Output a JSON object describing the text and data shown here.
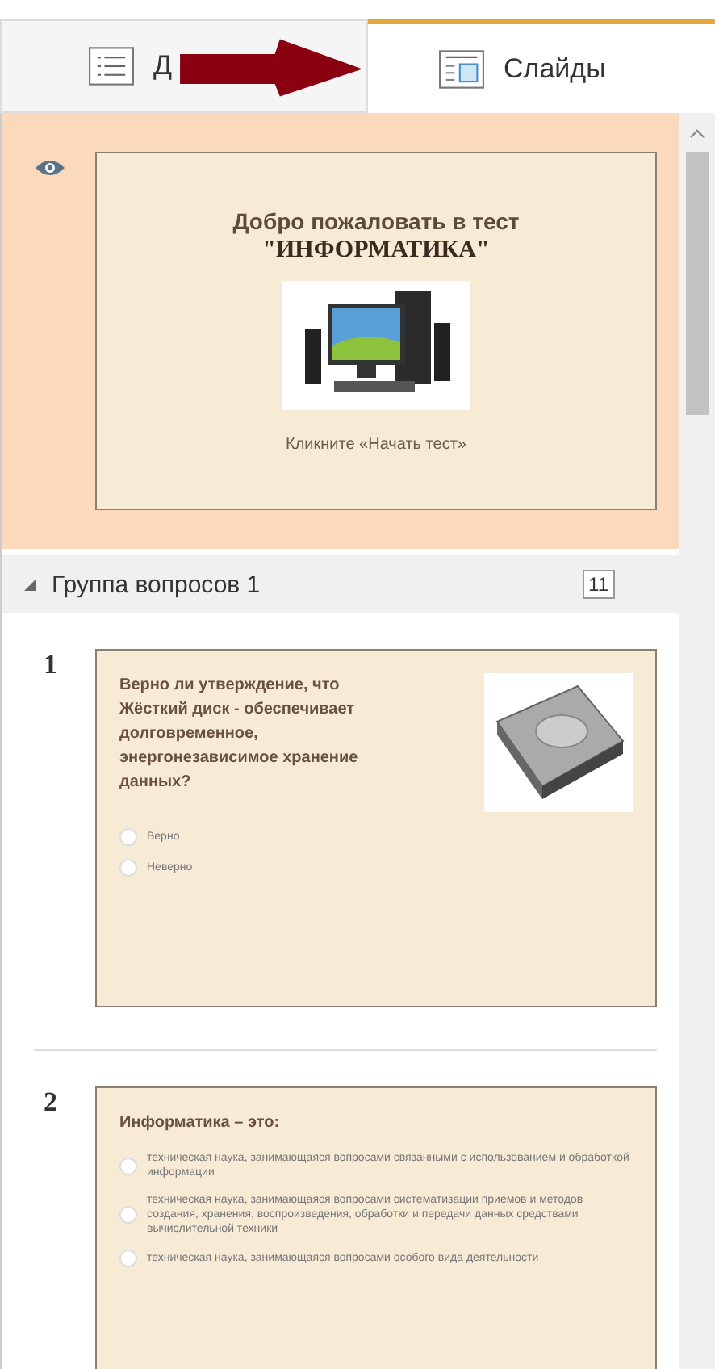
{
  "tabs": [
    {
      "label": "Д",
      "kind": "list",
      "selected": false
    },
    {
      "label": "Слайды",
      "kind": "slides",
      "selected": true
    }
  ],
  "start_slide": {
    "selected": true,
    "visible": true,
    "title_line_1": "Добро пожаловать в тест",
    "title_line_2": "\"ИНФОРМАТИКА\"",
    "hint": "Кликните «Начать тест»"
  },
  "group": {
    "title": "Группа вопросов 1",
    "count": "11",
    "expanded": true
  },
  "slides": [
    {
      "number": "1",
      "selected": false,
      "question": "Верно ли утверждение, что Жёсткий диск - обеспечивает долговременное, энергонезависимое хранение данных?",
      "has_image": true,
      "options": [
        {
          "text": "Верно",
          "selected": false
        },
        {
          "text": "Неверно",
          "selected": false
        }
      ]
    },
    {
      "number": "2",
      "selected": false,
      "question": "Информатика – это:",
      "has_image": false,
      "options": [
        {
          "text": "техническая наука, занимающаяся вопросами связанными с использованием и обработкой информации",
          "selected": false
        },
        {
          "text": "техническая наука, занимающаяся вопросами систематизации приемов и методов создания, хранения, воспроизведения, обработки и передачи данных средствами вычислительной техники",
          "selected": false
        },
        {
          "text": "техническая наука, занимающаяся вопросами особого вида деятельности",
          "selected": false
        }
      ]
    }
  ]
}
